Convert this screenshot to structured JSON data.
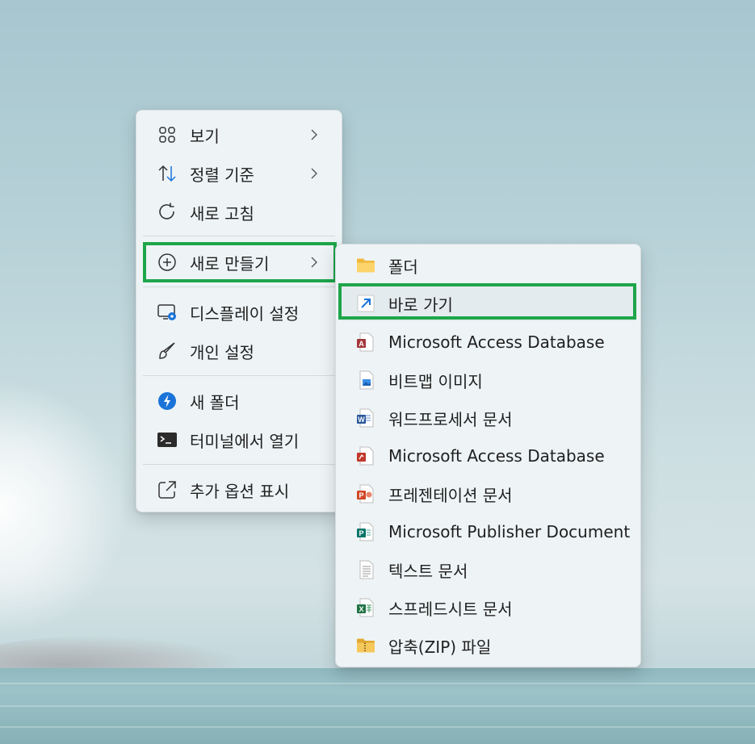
{
  "main_menu": {
    "items": [
      {
        "label": "보기",
        "icon": "grid-view-icon",
        "has_submenu": true
      },
      {
        "label": "정렬 기준",
        "icon": "sort-arrows-icon",
        "has_submenu": true
      },
      {
        "label": "새로 고침",
        "icon": "refresh-icon",
        "has_submenu": false
      },
      {
        "label": "새로 만들기",
        "icon": "add-circle-icon",
        "has_submenu": true
      },
      {
        "label": "디스플레이 설정",
        "icon": "display-settings-icon",
        "has_submenu": false
      },
      {
        "label": "개인 설정",
        "icon": "paintbrush-icon",
        "has_submenu": false
      },
      {
        "label": "새 폴더",
        "icon": "lightning-icon",
        "has_submenu": false
      },
      {
        "label": "터미널에서 열기",
        "icon": "terminal-icon",
        "has_submenu": false
      },
      {
        "label": "추가 옵션 표시",
        "icon": "open-external-icon",
        "has_submenu": false
      }
    ]
  },
  "sub_menu": {
    "items": [
      {
        "label": "폴더",
        "icon": "folder-icon"
      },
      {
        "label": "바로 가기",
        "icon": "shortcut-icon"
      },
      {
        "label": "Microsoft Access Database",
        "icon": "access-file-icon"
      },
      {
        "label": "비트맵 이미지",
        "icon": "bitmap-file-icon"
      },
      {
        "label": "워드프로세서 문서",
        "icon": "word-file-icon"
      },
      {
        "label": "Microsoft Access Database",
        "icon": "access-file-icon"
      },
      {
        "label": "프레젠테이션 문서",
        "icon": "powerpoint-file-icon"
      },
      {
        "label": "Microsoft Publisher Document",
        "icon": "publisher-file-icon"
      },
      {
        "label": "텍스트 문서",
        "icon": "text-file-icon"
      },
      {
        "label": "스프레드시트 문서",
        "icon": "excel-file-icon"
      },
      {
        "label": "압축(ZIP) 파일",
        "icon": "zip-folder-icon"
      }
    ]
  },
  "colors": {
    "highlight": "#1ea64a",
    "menu_bg": "#eef4f6",
    "accent_blue": "#1a73d9"
  }
}
